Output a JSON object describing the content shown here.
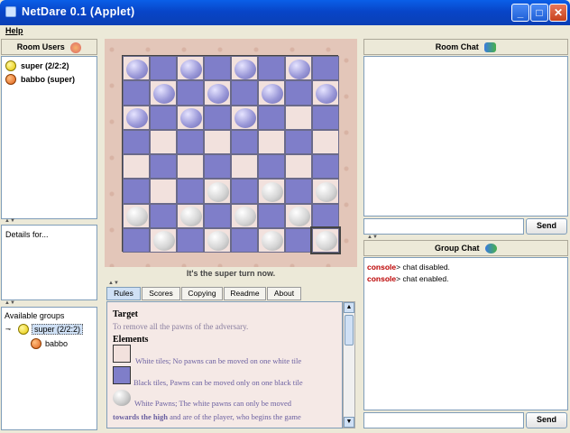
{
  "window": {
    "title": "NetDare 0.1 (Applet)",
    "min": "_",
    "max": "□",
    "close": "✕"
  },
  "menu": {
    "help": "Help"
  },
  "room_users": {
    "header": "Room Users",
    "users": [
      "super (2/2:2)",
      "babbo (super)"
    ]
  },
  "details": {
    "label": "Details for..."
  },
  "groups": {
    "label": "Available groups",
    "group": "super (2/2:2)",
    "member": "babbo"
  },
  "board": {
    "turn_text": "It's the super turn now.",
    "rows": [
      [
        "P",
        "L",
        "P",
        "L",
        "P",
        "L",
        "P",
        "L"
      ],
      [
        "L",
        "P",
        "L",
        "P",
        "L",
        "P",
        "L",
        "P"
      ],
      [
        "P",
        "L",
        "P",
        "L",
        "P",
        "L",
        "D",
        "L"
      ],
      [
        "L",
        "D",
        "L",
        "D",
        "L",
        "D",
        "L",
        "D"
      ],
      [
        "D",
        "L",
        "D",
        "L",
        "D",
        "L",
        "D",
        "L"
      ],
      [
        "L",
        "D",
        "L",
        "W",
        "L",
        "W",
        "L",
        "W"
      ],
      [
        "W",
        "L",
        "W",
        "L",
        "W",
        "L",
        "W",
        "L"
      ],
      [
        "L",
        "W",
        "L",
        "W",
        "L",
        "W",
        "L",
        "S"
      ]
    ]
  },
  "tabs": [
    "Rules",
    "Scores",
    "Copying",
    "Readme",
    "About"
  ],
  "rules": {
    "target_title": "Target",
    "target_text": "To remove all the pawns of the adversary.",
    "elements_title": "Elements",
    "white_tiles": "White tiles; No pawns can be moved on one white tile",
    "black_tiles": "Black tiles, Pawns can be moved only on one black tile",
    "white_pawns": "White Pawns; The white pawns can only be moved",
    "white_pawns_2a": "towards the high",
    "white_pawns_2b": " and are of the player, who begins the game"
  },
  "room_chat": {
    "header": "Room Chat",
    "send": "Send",
    "input": ""
  },
  "group_chat": {
    "header": "Group Chat",
    "send": "Send",
    "input": "",
    "lines": [
      {
        "who": "console",
        "sep": ">",
        "text": " chat disabled."
      },
      {
        "who": "console",
        "sep": ">",
        "text": " chat enabled."
      }
    ]
  },
  "colors": {
    "light_tile": "#f2e1dd",
    "dark_tile": "#7f7ec9",
    "titlebar": "#0845c8"
  }
}
